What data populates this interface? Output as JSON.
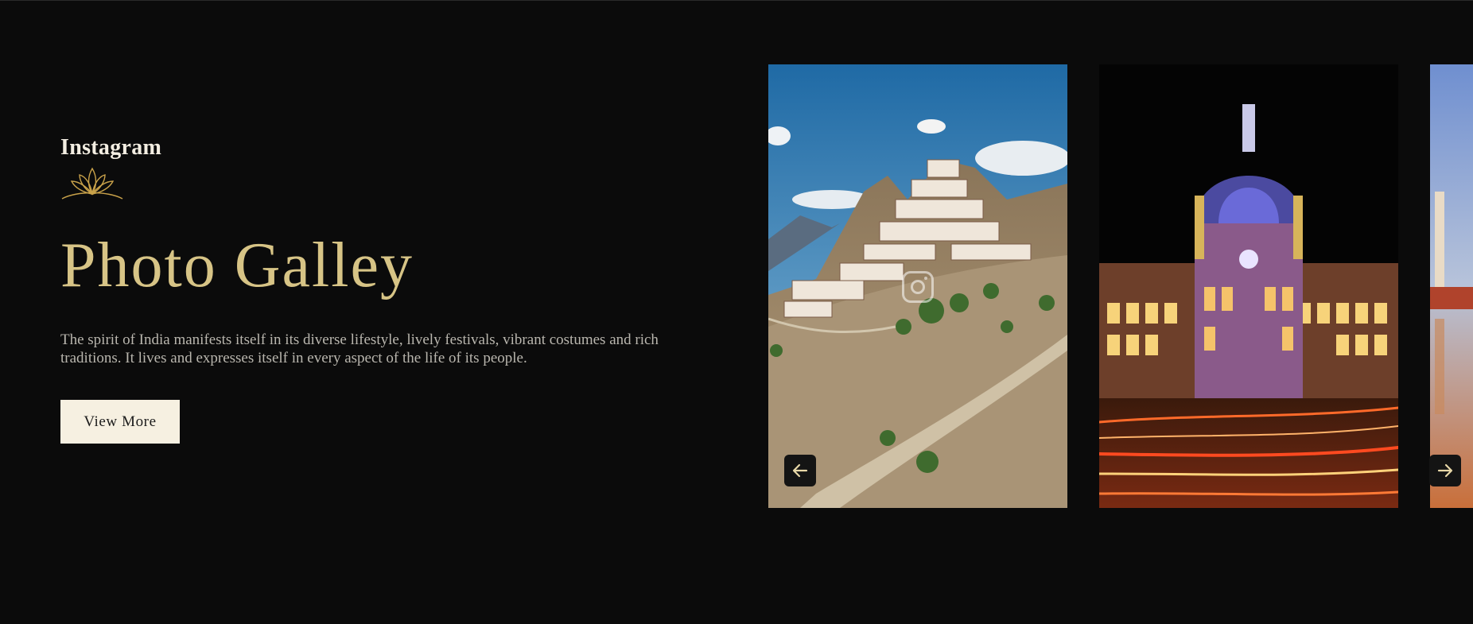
{
  "section": {
    "eyebrow": "Instagram",
    "title": "Photo Galley",
    "description": "The spirit of India manifests itself in its diverse lifestyle, lively festivals, vibrant costumes and rich traditions. It lives and expresses itself in every aspect of the life of its people.",
    "button_label": "View More"
  },
  "gallery": {
    "photos": [
      {
        "subject": "hilltop-monastery"
      },
      {
        "subject": "illuminated-railway-terminus"
      },
      {
        "subject": "taj-mahal-reflection"
      }
    ],
    "overlay_icon": "instagram-icon",
    "prev_icon": "arrow-left-icon",
    "next_icon": "arrow-right-icon"
  },
  "colors": {
    "background": "#0b0b0b",
    "accent_gold": "#d7c486",
    "button_bg": "#f6f0e1",
    "text_muted": "#b9b6ae"
  }
}
